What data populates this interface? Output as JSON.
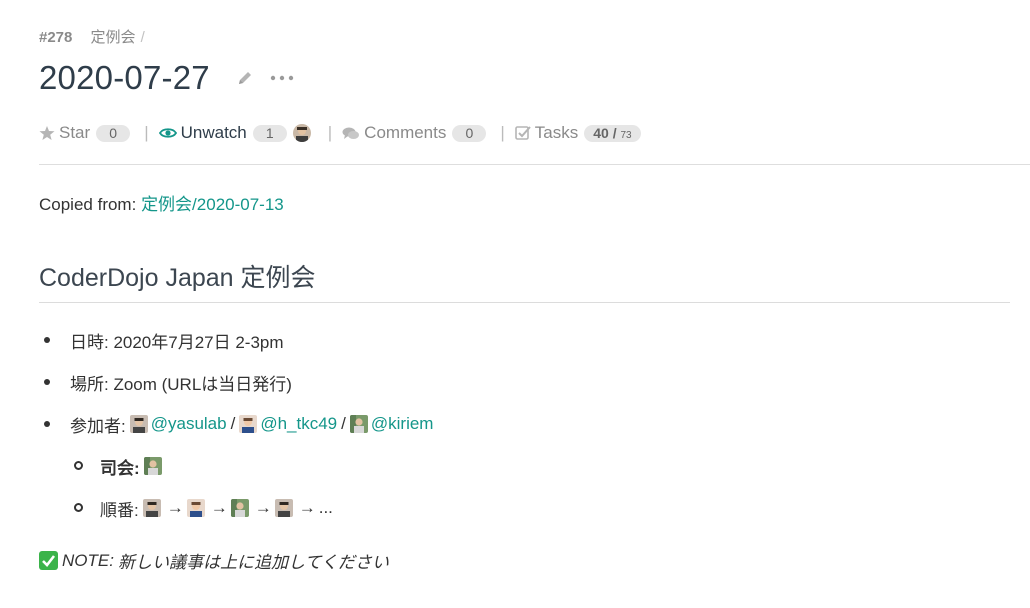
{
  "issue": {
    "number": "#278",
    "category": "定例会",
    "separator": "/",
    "title": "2020-07-27"
  },
  "meta": {
    "star_label": "Star",
    "star_count": "0",
    "watch_label": "Unwatch",
    "watch_count": "1",
    "comments_label": "Comments",
    "comments_count": "0",
    "tasks_label": "Tasks",
    "tasks_done": "40",
    "tasks_sep": "/",
    "tasks_total": "73"
  },
  "body": {
    "copied_prefix": "Copied from:",
    "copied_link": "定例会/2020-07-13",
    "heading": "CoderDojo Japan 定例会",
    "datetime": "日時: 2020年7月27日 2-3pm",
    "place": "場所: Zoom (URLは当日発行)",
    "participants_label": "参加者:",
    "participants": [
      "@yasulab",
      "@h_tkc49",
      "@kiriem"
    ],
    "participant_sep": "/",
    "host_label": "司会:",
    "order_label": "順番:",
    "arrow": "→",
    "ellipsis": "...",
    "note_label": "NOTE:",
    "note_text": "新しい議事は上に追加してください"
  },
  "colors": {
    "link": "#14968a",
    "title": "#2f3d4a",
    "muted": "#8a8a8a",
    "pill_bg": "#e6e6e6",
    "check": "#3bb34a"
  }
}
